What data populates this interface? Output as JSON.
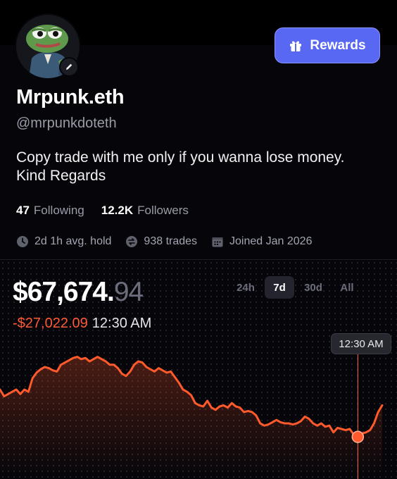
{
  "profile": {
    "display_name": "Mrpunk.eth",
    "handle": "@mrpunkdoteth",
    "bio_line1": "Copy trade with me only if you wanna lose money.",
    "bio_line2": "Kind Regards",
    "avatar_icon": "frog-avatar",
    "edit_icon": "pencil-icon"
  },
  "rewards_button": {
    "label": "Rewards",
    "icon": "gift-icon"
  },
  "stats": {
    "following_count": "47",
    "following_label": "Following",
    "followers_count": "12.2K",
    "followers_label": "Followers"
  },
  "meta": {
    "avg_hold": "2d 1h avg. hold",
    "trades": "938 trades",
    "joined": "Joined Jan 2026"
  },
  "balance": {
    "main": "$67,674.",
    "cents": "94"
  },
  "change": {
    "amount": "-$27,022.09",
    "time": "12:30 AM"
  },
  "ranges": [
    {
      "label": "24h",
      "active": false
    },
    {
      "label": "7d",
      "active": true
    },
    {
      "label": "30d",
      "active": false
    },
    {
      "label": "All",
      "active": false
    }
  ],
  "tooltip": {
    "time": "12:30 AM"
  },
  "colors": {
    "accent": "#5968f2",
    "line": "#ff5a2c",
    "negative": "#ff5a36"
  },
  "chart_data": {
    "type": "line",
    "title": "",
    "xlabel": "",
    "ylabel": "",
    "grid": false,
    "ylim": [
      0,
      100
    ],
    "values": [
      60,
      54,
      56,
      58,
      60,
      56,
      60,
      58,
      70,
      75,
      78,
      80,
      79,
      77,
      76,
      82,
      84,
      86,
      88,
      89,
      87,
      88,
      85,
      87,
      89,
      87,
      85,
      82,
      82,
      79,
      74,
      72,
      76,
      82,
      85,
      84,
      80,
      78,
      76,
      79,
      77,
      75,
      76,
      71,
      66,
      60,
      58,
      55,
      48,
      46,
      45,
      50,
      44,
      42,
      45,
      46,
      44,
      48,
      45,
      44,
      40,
      41,
      40,
      37,
      30,
      28,
      29,
      31,
      33,
      31,
      30,
      30,
      29,
      30,
      32,
      36,
      34,
      30,
      28,
      30,
      27,
      28,
      22,
      26,
      25,
      24,
      25,
      20,
      18,
      21,
      22,
      24,
      30,
      40,
      46
    ],
    "marker_index": 88
  }
}
